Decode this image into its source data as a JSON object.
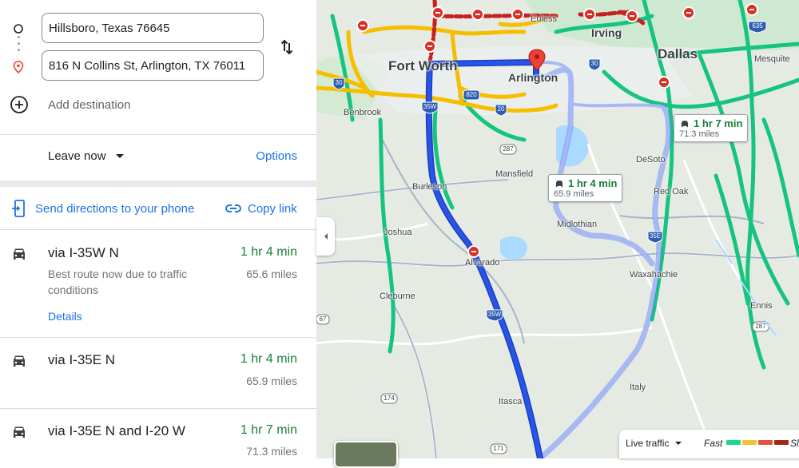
{
  "directions": {
    "origin_value": "Hillsboro, Texas 76645",
    "destination_value": "816 N Collins St, Arlington, TX 76011",
    "add_destination_label": "Add destination",
    "leave_now_label": "Leave now",
    "options_label": "Options",
    "send_to_phone_label": "Send directions to your phone",
    "copy_link_label": "Copy link"
  },
  "routes": [
    {
      "via": "via I-35W N",
      "time": "1 hr 4 min",
      "distance": "65.6 miles",
      "description": "Best route now due to traffic conditions",
      "details_label": "Details"
    },
    {
      "via": "via I-35E N",
      "time": "1 hr 4 min",
      "distance": "65.9 miles"
    },
    {
      "via": "via I-35E N and I-20 W",
      "time": "1 hr 7 min",
      "distance": "71.3 miles"
    }
  ],
  "map": {
    "cities": {
      "fort_worth": "Fort Worth",
      "arlington": "Arlington",
      "dallas": "Dallas",
      "irving": "Irving",
      "euless": "Euless",
      "mesquite": "Mesquite",
      "benbrook": "Benbrook",
      "mansfield": "Mansfield",
      "desoto": "DeSoto",
      "red_oak": "Red Oak",
      "burleson": "Burleson",
      "midlothian": "Midlothian",
      "joshua": "Joshua",
      "alvarado": "Alvarado",
      "waxahachie": "Waxahachie",
      "cleburne": "Cleburne",
      "ennis": "Ennis",
      "italy": "Italy",
      "itasca": "Itasca"
    },
    "shields": {
      "i30_left": "30",
      "i30_right": "30",
      "i35w_top": "35W",
      "i35w_bottom": "35W",
      "i35e": "35E",
      "i20": "20",
      "hwy820": "820",
      "hwy287_top": "287",
      "hwy287_right": "287",
      "i635": "635",
      "hwy67": "67",
      "hwy174": "174",
      "hwy171": "171"
    },
    "bubble_route2": {
      "time": "1 hr 4 min",
      "distance": "65.9 miles"
    },
    "bubble_route3": {
      "time": "1 hr 7 min",
      "distance": "71.3 miles"
    }
  },
  "traffic_legend": {
    "live_label": "Live traffic",
    "fast_label": "Fast",
    "slow_label": "Sl",
    "colors": [
      "#1ed78f",
      "#f4c430",
      "#e6513e",
      "#a52714"
    ]
  }
}
